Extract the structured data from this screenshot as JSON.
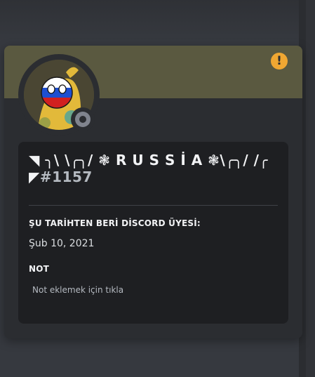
{
  "colors": {
    "banner": "#5a5940",
    "card": "#2b2d31",
    "info_panel": "#1e1f22",
    "warning": "#f0a732",
    "status_offline": "#80848e"
  },
  "warning": {
    "icon": "exclamation-icon",
    "symbol": "!"
  },
  "profile": {
    "username": "◥ ╮\\ \\╭╮/ ❃ R U S S İ A ❃\\╭╮/ /╭ ◤",
    "discriminator": "#1157",
    "status": "offline",
    "avatar": "countryball-russia-avatar"
  },
  "member_since": {
    "title": "ŞU TARİHTEN BERİ DİSCORD ÜYESİ:",
    "date": "Şub 10, 2021"
  },
  "note": {
    "title": "NOT",
    "placeholder": "Not eklemek için tıkla"
  }
}
